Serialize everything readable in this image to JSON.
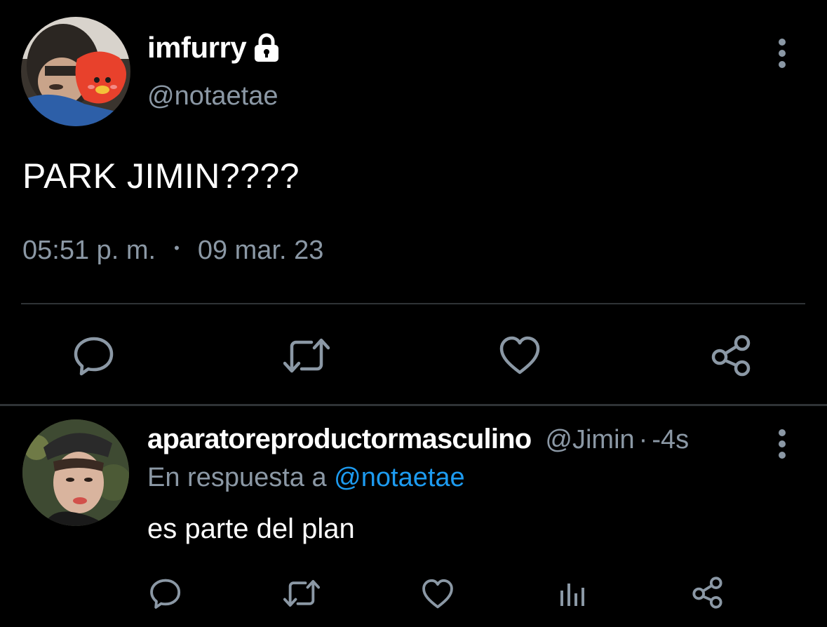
{
  "main_tweet": {
    "display_name": "imfurry",
    "handle": "@notaetae",
    "protected_icon": "lock-icon",
    "text": "PARK JIMIN????",
    "time": "05:51 p. m.",
    "separator": "•",
    "date": "09 mar. 23",
    "actions": [
      "reply-icon",
      "retweet-icon",
      "like-icon",
      "share-icon"
    ]
  },
  "reply": {
    "display_name": "aparatoreproductormasculino",
    "handle": "@Jimin",
    "separator": "·",
    "time": "-4s",
    "reply_prefix": "En respuesta a",
    "reply_mention": "@notaetae",
    "text": "es parte del plan",
    "actions": [
      "reply-icon",
      "retweet-icon",
      "like-icon",
      "analytics-icon",
      "share-icon"
    ]
  },
  "colors": {
    "background": "#000000",
    "text_primary": "#ffffff",
    "text_secondary": "#8b98a5",
    "icon": "#8b98a5",
    "link": "#1d9bf0",
    "divider": "#2f3336"
  }
}
